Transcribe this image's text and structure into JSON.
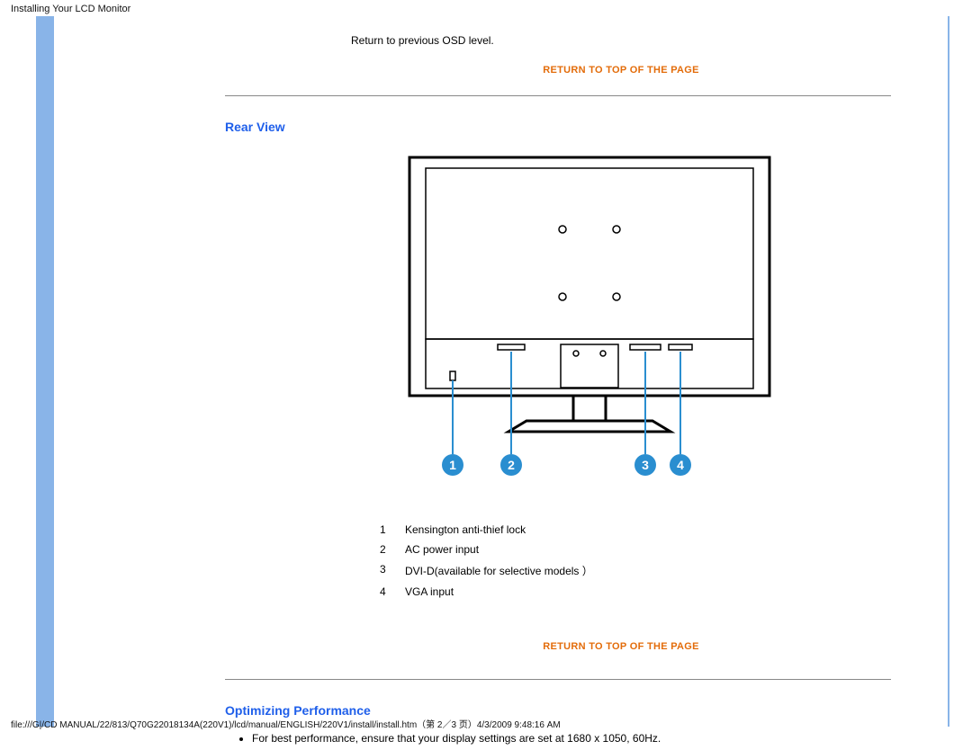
{
  "header": {
    "title": "Installing Your LCD Monitor"
  },
  "osd": {
    "text": "Return to previous OSD level."
  },
  "links": {
    "return_top": "RETURN TO TOP OF THE PAGE"
  },
  "sections": {
    "rear_view": "Rear View",
    "optimizing": "Optimizing Performance"
  },
  "callouts": {
    "c1": "1",
    "c2": "2",
    "c3": "3",
    "c4": "4"
  },
  "legend": [
    {
      "n": "1",
      "t": "Kensington anti-thief lock"
    },
    {
      "n": "2",
      "t": "AC power input"
    },
    {
      "n": "3",
      "t": "DVI-D(available for selective models ）"
    },
    {
      "n": "4",
      "t": "VGA input"
    }
  ],
  "optimizing_bullets": [
    "For best performance, ensure that your display settings are set at 1680 x 1050, 60Hz."
  ],
  "footer": {
    "path": "file:///G|/CD MANUAL/22/813/Q70G22018134A(220V1)/lcd/manual/ENGLISH/220V1/install/install.htm（第 2／3 页）4/3/2009 9:48:16 AM"
  }
}
